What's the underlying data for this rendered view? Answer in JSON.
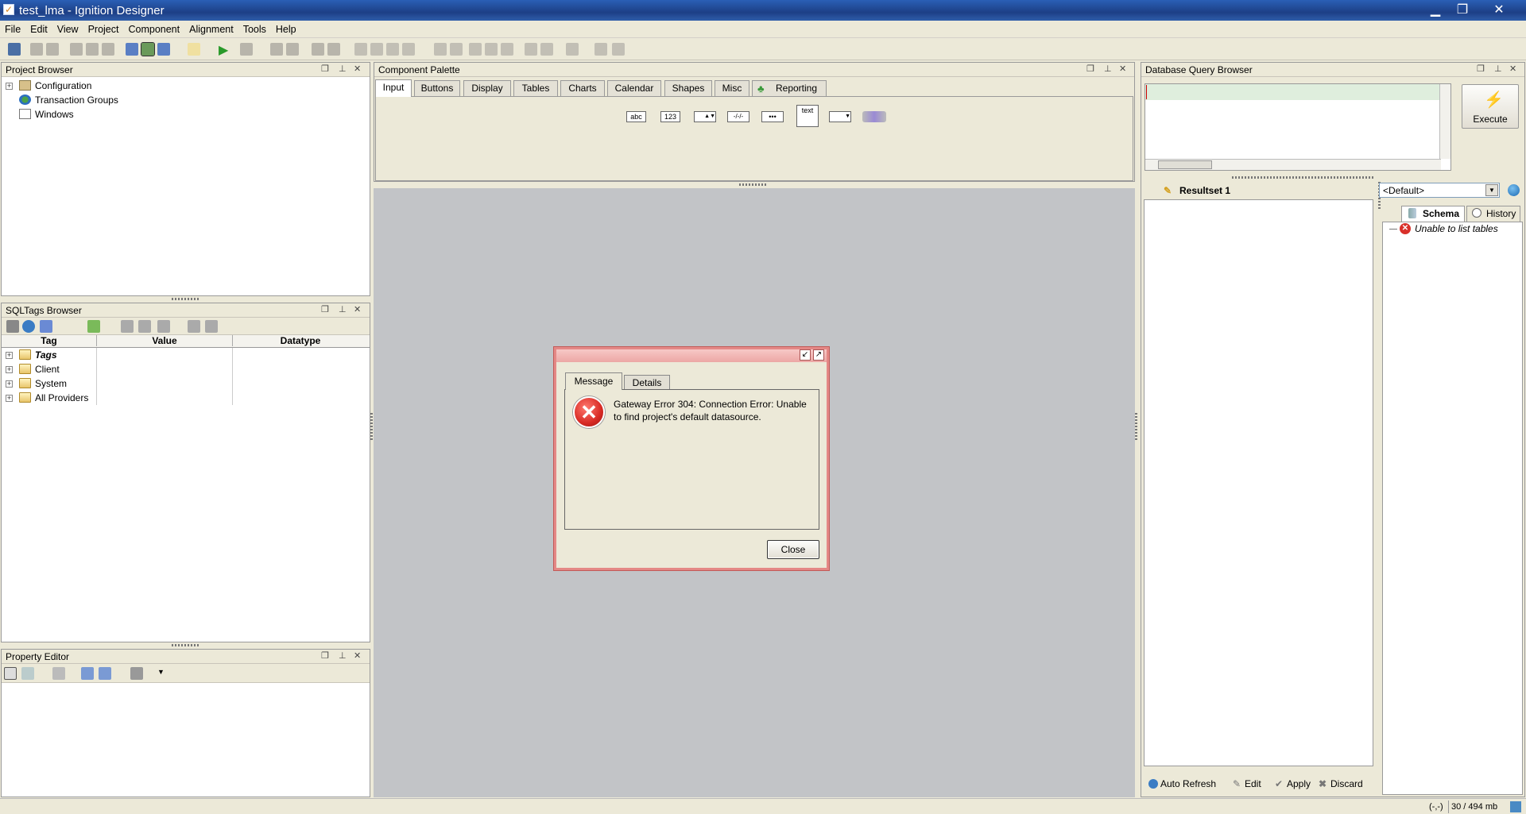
{
  "window": {
    "title": "test_lma - Ignition Designer"
  },
  "menu": [
    "File",
    "Edit",
    "View",
    "Project",
    "Component",
    "Alignment",
    "Tools",
    "Help"
  ],
  "project_browser": {
    "title": "Project Browser",
    "items": [
      "Configuration",
      "Transaction Groups",
      "Windows"
    ]
  },
  "sqltags": {
    "title": "SQLTags Browser",
    "columns": [
      "Tag",
      "Value",
      "Datatype"
    ],
    "rows": [
      "Tags",
      "Client",
      "System",
      "All Providers"
    ]
  },
  "property_editor": {
    "title": "Property Editor"
  },
  "palette": {
    "title": "Component Palette",
    "tabs": [
      "Input",
      "Buttons",
      "Display",
      "Tables",
      "Charts",
      "Calendar",
      "Shapes",
      "Misc",
      "Reporting"
    ],
    "widgets": [
      "abc",
      "123",
      "",
      "-/-/-",
      "•••",
      "text",
      "",
      ""
    ]
  },
  "dialog": {
    "tabs": [
      "Message",
      "Details"
    ],
    "message": "Gateway Error 304: Connection Error: Unable to find project's default datasource.",
    "close": "Close"
  },
  "dbq": {
    "title": "Database Query Browser",
    "execute": "Execute",
    "resultset_tab": "Resultset 1",
    "datasource": "<Default>",
    "schema_tab": "Schema",
    "history_tab": "History",
    "schema_msg": "Unable to list tables",
    "buttons": [
      "Auto Refresh",
      "Edit",
      "Apply",
      "Discard"
    ]
  },
  "status": {
    "coords": "(-,-)",
    "memory": "30 / 494 mb"
  },
  "colors": {
    "accent": "#2a5fb5",
    "error": "#d9302a",
    "dialog_border": "#e07a78"
  }
}
